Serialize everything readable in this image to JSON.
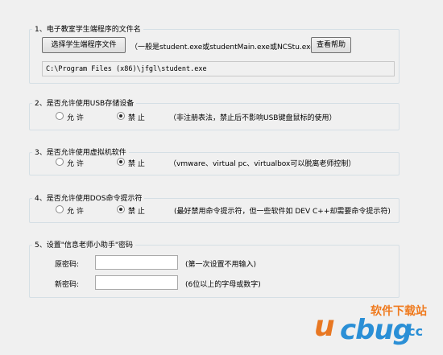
{
  "section1": {
    "title": "1、电子教室学生端程序的文件名",
    "select_button": "选择学生端程序文件",
    "hint": "（一般是student.exe或studentMain.exe或NCStu.exe）",
    "help_button": "查看帮助",
    "path_value": "C:\\Program Files (x86)\\jfgl\\student.exe"
  },
  "section2": {
    "title": "2、是否允许使用USB存储设备",
    "allow": "允 许",
    "deny": "禁 止",
    "selected": "deny",
    "note": "（非注册表法，禁止后不影响USB键盘鼠标的使用）"
  },
  "section3": {
    "title": "3、是否允许使用虚拟机软件",
    "allow": "允 许",
    "deny": "禁 止",
    "selected": "deny",
    "note": "（vmware、virtual pc、virtualbox可以脱离老师控制）"
  },
  "section4": {
    "title": "4、是否允许使用DOS命令提示符",
    "allow": "允 许",
    "deny": "禁 止",
    "selected": "deny",
    "note": "(最好禁用命令提示符，但一些软件如 DEV C++却需要命令提示符)"
  },
  "section5": {
    "title": "5、设置\"信息老师小助手\"密码",
    "old_label": "原密码:",
    "old_value": "",
    "old_note": "(第一次设置不用输入)",
    "new_label": "新密码:",
    "new_value": "",
    "new_note": "(6位以上的字母或数字)"
  },
  "watermark": {
    "cn": "软件下载站",
    "u": "u",
    "bug": "cbug",
    "cc": ".cc"
  },
  "colors": {
    "background": "#f0f0f0",
    "group_border": "#d5dfe5",
    "watermark_orange": "#e87722",
    "watermark_blue": "#2a8fd6"
  }
}
